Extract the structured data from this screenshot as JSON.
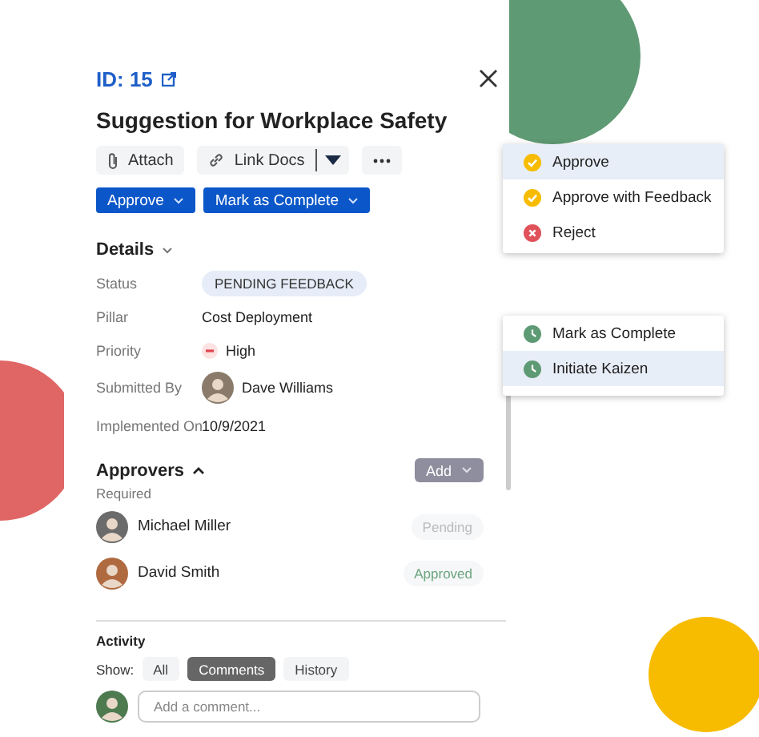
{
  "header": {
    "id_label": "ID: 15",
    "title": "Suggestion for Workplace Safety"
  },
  "toolbar": [
    {
      "label": "Attach",
      "kind": "attach"
    },
    {
      "label": "Link Docs",
      "kind": "link"
    },
    {
      "kind": "more"
    }
  ],
  "actions": [
    {
      "label": "Approve"
    },
    {
      "label": "Mark as Complete"
    }
  ],
  "details": {
    "title": "Details",
    "fields": [
      {
        "label": "Status",
        "value": "PENDING FEEDBACK",
        "kind": "status"
      },
      {
        "label": "Pillar",
        "value": "Cost Deployment",
        "kind": "text"
      },
      {
        "label": "Priority",
        "value": "High",
        "kind": "priority"
      },
      {
        "label": "Submitted By",
        "value": "Dave Williams",
        "kind": "person"
      },
      {
        "label": "Implemented On",
        "value": "10/9/2021",
        "kind": "text"
      }
    ]
  },
  "approvers": {
    "title": "Approvers",
    "add_button": "Add",
    "required_label": "Required",
    "items": [
      {
        "name": "Michael Miller",
        "status": "Pending",
        "kind": "pending"
      },
      {
        "name": "David Smith",
        "status": "Approved",
        "kind": "approved"
      }
    ]
  },
  "activity": {
    "title": "Activity",
    "show_label": "Show:",
    "filters": [
      {
        "label": "All",
        "selected": false
      },
      {
        "label": "Comments",
        "selected": true
      },
      {
        "label": "History",
        "selected": false
      }
    ],
    "comment_placeholder": "Add a comment..."
  },
  "approve_menu": [
    {
      "label": "Approve",
      "kind": "approve",
      "selected": true
    },
    {
      "label": "Approve with Feedback",
      "kind": "approve",
      "selected": false
    },
    {
      "label": "Reject",
      "kind": "reject",
      "selected": false
    }
  ],
  "complete_menu": [
    {
      "label": "Mark as Complete",
      "kind": "clock",
      "selected": false
    },
    {
      "label": "Initiate Kaizen",
      "kind": "clock",
      "selected": true
    }
  ]
}
